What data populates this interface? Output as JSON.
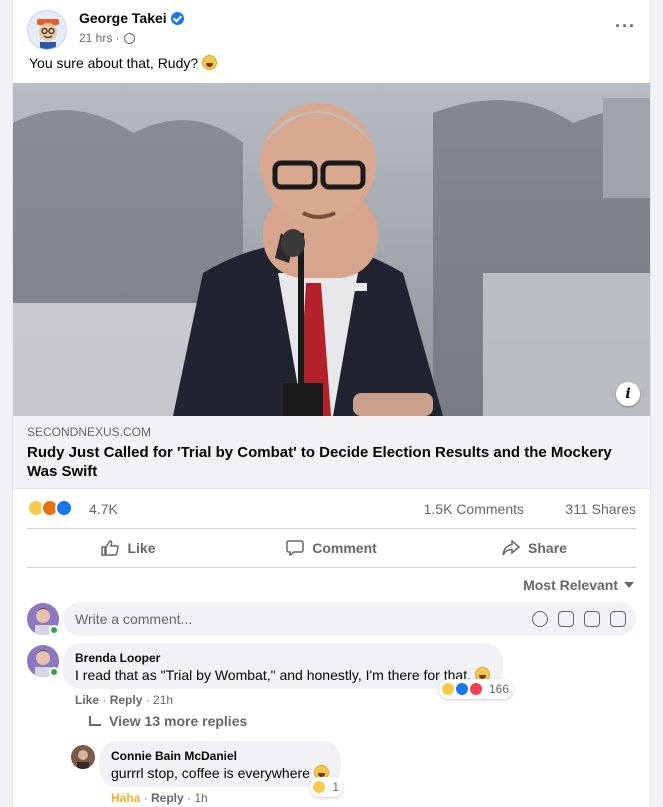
{
  "post": {
    "author": "George Takei",
    "time": "21 hrs ·",
    "text": "You sure about that, Rudy?",
    "more_label": "···"
  },
  "link": {
    "domain": "SECONDNEXUS.COM",
    "title": "Rudy Just Called for 'Trial by Combat' to Decide Election Results and the Mockery Was Swift",
    "info_label": "i"
  },
  "stats": {
    "reactions": "4.7K",
    "comments": "1.5K Comments",
    "shares": "311 Shares"
  },
  "actions": {
    "like": "Like",
    "comment": "Comment",
    "share": "Share"
  },
  "sort_label": "Most Relevant",
  "composer": {
    "placeholder": "Write a comment..."
  },
  "comments": [
    {
      "name": "Brenda Looper",
      "text": "I read that as \"Trial by Wombat,\" and honestly, I'm there for that.",
      "reaction_count": "166",
      "like": "Like",
      "reply": "Reply",
      "time": "21h"
    },
    {
      "name": "Connie Bain McDaniel",
      "text": "gurrrl stop, coffee is everywhere",
      "reaction_count": "1",
      "like": "Haha",
      "reply": "Reply",
      "time": "1h"
    }
  ],
  "view_more_replies": "View 13 more replies",
  "colors": {
    "accent": "#1877f2",
    "haha": "#f7b125",
    "muted": "#65676b"
  },
  "icons": [
    "verified-icon",
    "globe-icon",
    "more-icon",
    "info-icon",
    "like-icon",
    "comment-icon",
    "share-icon",
    "emoji-icon",
    "camera-icon",
    "gif-icon",
    "sticker-icon"
  ]
}
